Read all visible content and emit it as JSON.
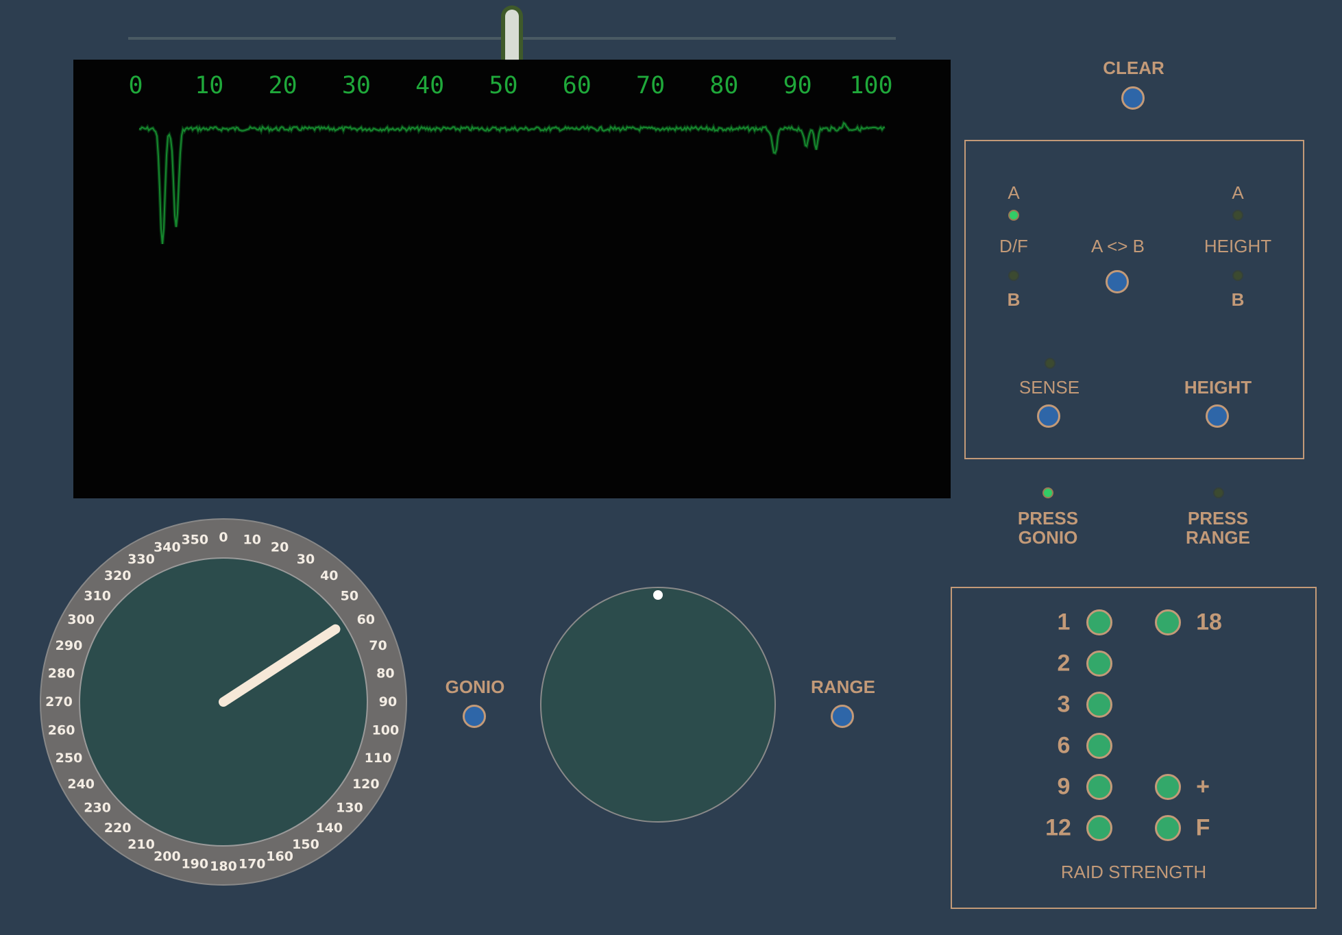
{
  "range_slider": {
    "value": 0.5
  },
  "scope": {
    "scale_labels": [
      "0",
      "10",
      "20",
      "30",
      "40",
      "50",
      "60",
      "70",
      "80",
      "90",
      "100"
    ]
  },
  "top_buttons": {
    "clear_label": "CLEAR"
  },
  "mode_panel": {
    "df_a": "A",
    "df_label": "D/F",
    "df_b": "B",
    "ab_label": "A <> B",
    "height_a": "A",
    "height_label": "HEIGHT",
    "height_b": "B",
    "sense_label": "SENSE",
    "height_button_label": "HEIGHT",
    "df_a_lit": true,
    "df_b_lit": false,
    "height_a_lit": false,
    "height_b_lit": false,
    "sense_lit": false
  },
  "press": {
    "gonio_label": "PRESS\nGONIO",
    "range_label": "PRESS\nRANGE",
    "gonio_lit": true,
    "range_lit": false
  },
  "gonio_dial": {
    "bearing_deg": 57,
    "degree_labels": [
      "0",
      "10",
      "20",
      "30",
      "40",
      "50",
      "60",
      "70",
      "80",
      "90",
      "100",
      "110",
      "120",
      "130",
      "140",
      "150",
      "160",
      "170",
      "180",
      "190",
      "200",
      "210",
      "220",
      "230",
      "240",
      "250",
      "260",
      "270",
      "280",
      "290",
      "300",
      "310",
      "320",
      "330",
      "340",
      "350"
    ]
  },
  "controls": {
    "gonio_label": "GONIO",
    "range_label": "RANGE"
  },
  "raid_strength": {
    "title": "RAID STRENGTH",
    "left": [
      "1",
      "2",
      "3",
      "6",
      "9",
      "12"
    ],
    "right": [
      "18",
      "+",
      "F"
    ]
  },
  "colors": {
    "background": "#2d3e50",
    "accent": "#c39a78",
    "trace": "#1fa83a",
    "button": "#2e66a8",
    "led_on": "#33cc66"
  }
}
